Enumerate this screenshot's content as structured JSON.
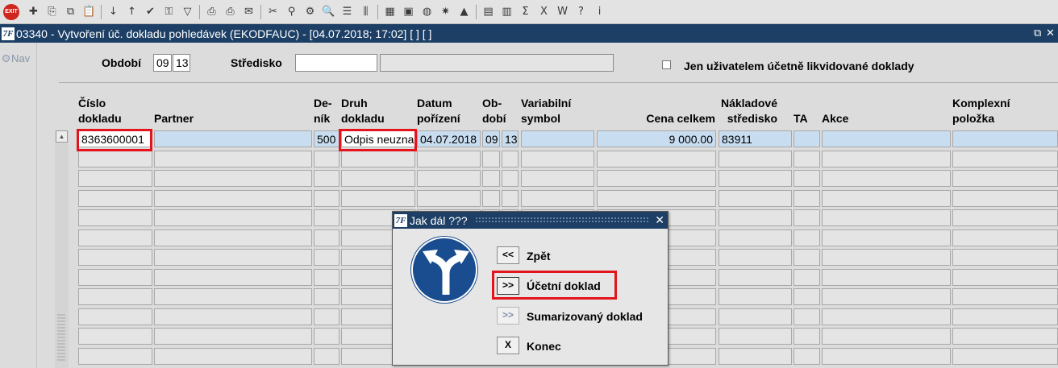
{
  "toolbar": {
    "exit_label": "EXIT",
    "icons": [
      "new-record-icon",
      "cut-icon",
      "copy-icon",
      "paste-icon",
      "sort-asc-icon",
      "sort-desc-icon",
      "check-icon",
      "key-icon",
      "filter-icon",
      "print-icon",
      "print-setup-icon",
      "mail-icon",
      "scissors-icon",
      "pin-icon",
      "gear-icon",
      "search-icon",
      "list-icon",
      "tree-icon",
      "calculator-icon",
      "save-icon",
      "globe-icon",
      "sun-icon",
      "triangle-icon",
      "chart-icon",
      "db-icon",
      "sigma-icon",
      "excel-icon",
      "word-icon",
      "help-icon",
      "info-icon"
    ],
    "glyphs": [
      "✚",
      "⎘",
      "⧉",
      "📋",
      "↓",
      "↑",
      "✔",
      "⚿",
      "▽",
      "⎙",
      "⎙",
      "✉",
      "✂",
      "⚲",
      "⚙",
      "🔍",
      "☰",
      "⫼",
      "▦",
      "▣",
      "◍",
      "✷",
      "▲",
      "▤",
      "▥",
      "Σ",
      "X",
      "W",
      "?",
      "i"
    ]
  },
  "window": {
    "title": "03340 - Vytvoření úč. dokladu pohledávek (EKODFAUC) - [04.07.2018; 17:02]  [ ]  [ ]",
    "logo_text": "7F"
  },
  "nav": {
    "label": "Nav"
  },
  "filters": {
    "obdobi_label": "Období",
    "obdobi_month": "09",
    "obdobi_day": "13",
    "stredisko_label": "Středisko",
    "stredisko_value": "",
    "stredisko_name": "",
    "checkbox_label": "Jen uživatelem účetně likvidované doklady"
  },
  "grid": {
    "headers": {
      "cislo": [
        "Číslo",
        "dokladu"
      ],
      "partner": "Partner",
      "denik": [
        "De-",
        "ník"
      ],
      "druh": [
        "Druh",
        "dokladu"
      ],
      "datum": [
        "Datum",
        "pořízení"
      ],
      "obdobi": [
        "Ob-",
        "dobí"
      ],
      "vs": [
        "Variabilní",
        "symbol"
      ],
      "cena": "Cena celkem",
      "nakl": [
        "Nákladové",
        "středisko"
      ],
      "ta": "TA",
      "akce": "Akce",
      "komplex": [
        "Komplexní",
        "položka"
      ]
    },
    "row1": {
      "cislo": "8363600001",
      "partner": "",
      "denik": "500",
      "druh": "Odpis neuzna",
      "datum": "04.07.2018",
      "ob1": "09",
      "ob2": "13",
      "vs": "",
      "cena": "9 000.00",
      "nakl": "83911",
      "ta": "",
      "akce": "",
      "komplex": ""
    }
  },
  "dialog": {
    "title": "Jak dál ???",
    "buttons": [
      {
        "symbol": "<<",
        "label": "Zpět"
      },
      {
        "symbol": ">>",
        "label": "Účetní doklad"
      },
      {
        "symbol": ">>",
        "label": "Sumarizovaný doklad"
      },
      {
        "symbol": "X",
        "label": "Konec"
      }
    ]
  },
  "colors": {
    "titlebar": "#1d3f66",
    "selected_row": "#c8ddf0",
    "highlight": "#e3141b",
    "sign_blue": "#1a4d8f"
  }
}
